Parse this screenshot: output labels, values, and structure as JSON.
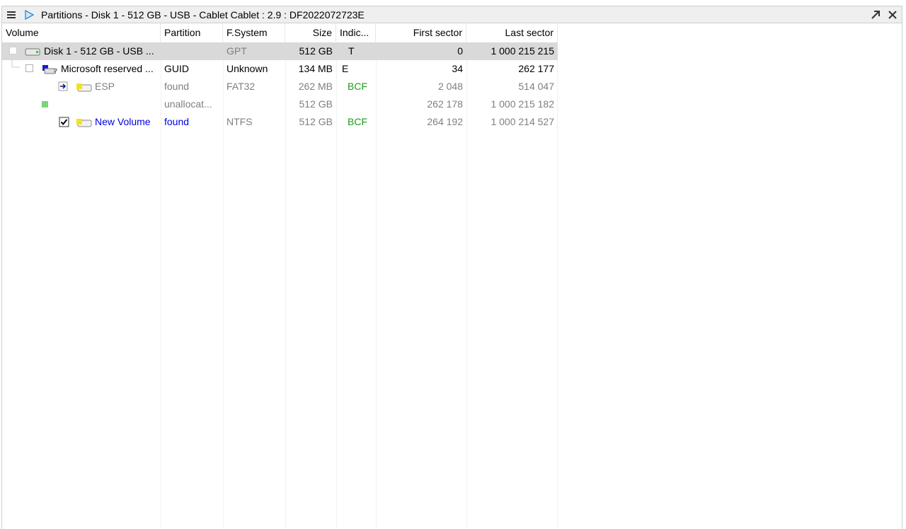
{
  "window": {
    "title": "Partitions - Disk 1 - 512 GB - USB - Cablet Cablet : 2.9 : DF2022072723E",
    "menu_icon": "hamburger-menu-icon",
    "play_icon": "play-triangle-icon",
    "maximize_icon": "diagonal-arrow-icon",
    "close_icon": "close-x-icon"
  },
  "columns": [
    "Volume",
    "Partition",
    "F.System",
    "Size",
    "Indic...",
    "First sector",
    "Last sector"
  ],
  "rows": [
    {
      "volume": "Disk 1 - 512 GB - USB ...",
      "partition": "",
      "fs": "GPT",
      "size": "512 GB",
      "indicators": "T",
      "first": "0",
      "last": "1 000 215 215",
      "icon": "usb-drive-icon"
    },
    {
      "volume": "Microsoft reserved ...",
      "partition": "GUID",
      "fs": "Unknown",
      "size": "134 MB",
      "indicators": "E",
      "first": "34",
      "last": "262 177",
      "icon": "unknown-partition-icon"
    },
    {
      "volume": "ESP",
      "partition": "found",
      "fs": "FAT32",
      "size": "262 MB",
      "indicators": "BCF",
      "first": "2 048",
      "last": "514 047",
      "icon": "partition-yellow-icon"
    },
    {
      "volume": "",
      "partition": "unallocat...",
      "fs": "",
      "size": "512 GB",
      "indicators": "",
      "first": "262 178",
      "last": "1 000 215 182",
      "icon": "unallocated-green-square-icon"
    },
    {
      "volume": "New Volume",
      "partition": "found",
      "fs": "NTFS",
      "size": "512 GB",
      "indicators": "BCF",
      "first": "264 192",
      "last": "1 000 214 527",
      "icon": "partition-yellow-icon"
    }
  ],
  "colors": {
    "found_blue": "#0000e0",
    "indicator_green": "#1d9a1d",
    "selected_row": "#d9d9d9"
  }
}
